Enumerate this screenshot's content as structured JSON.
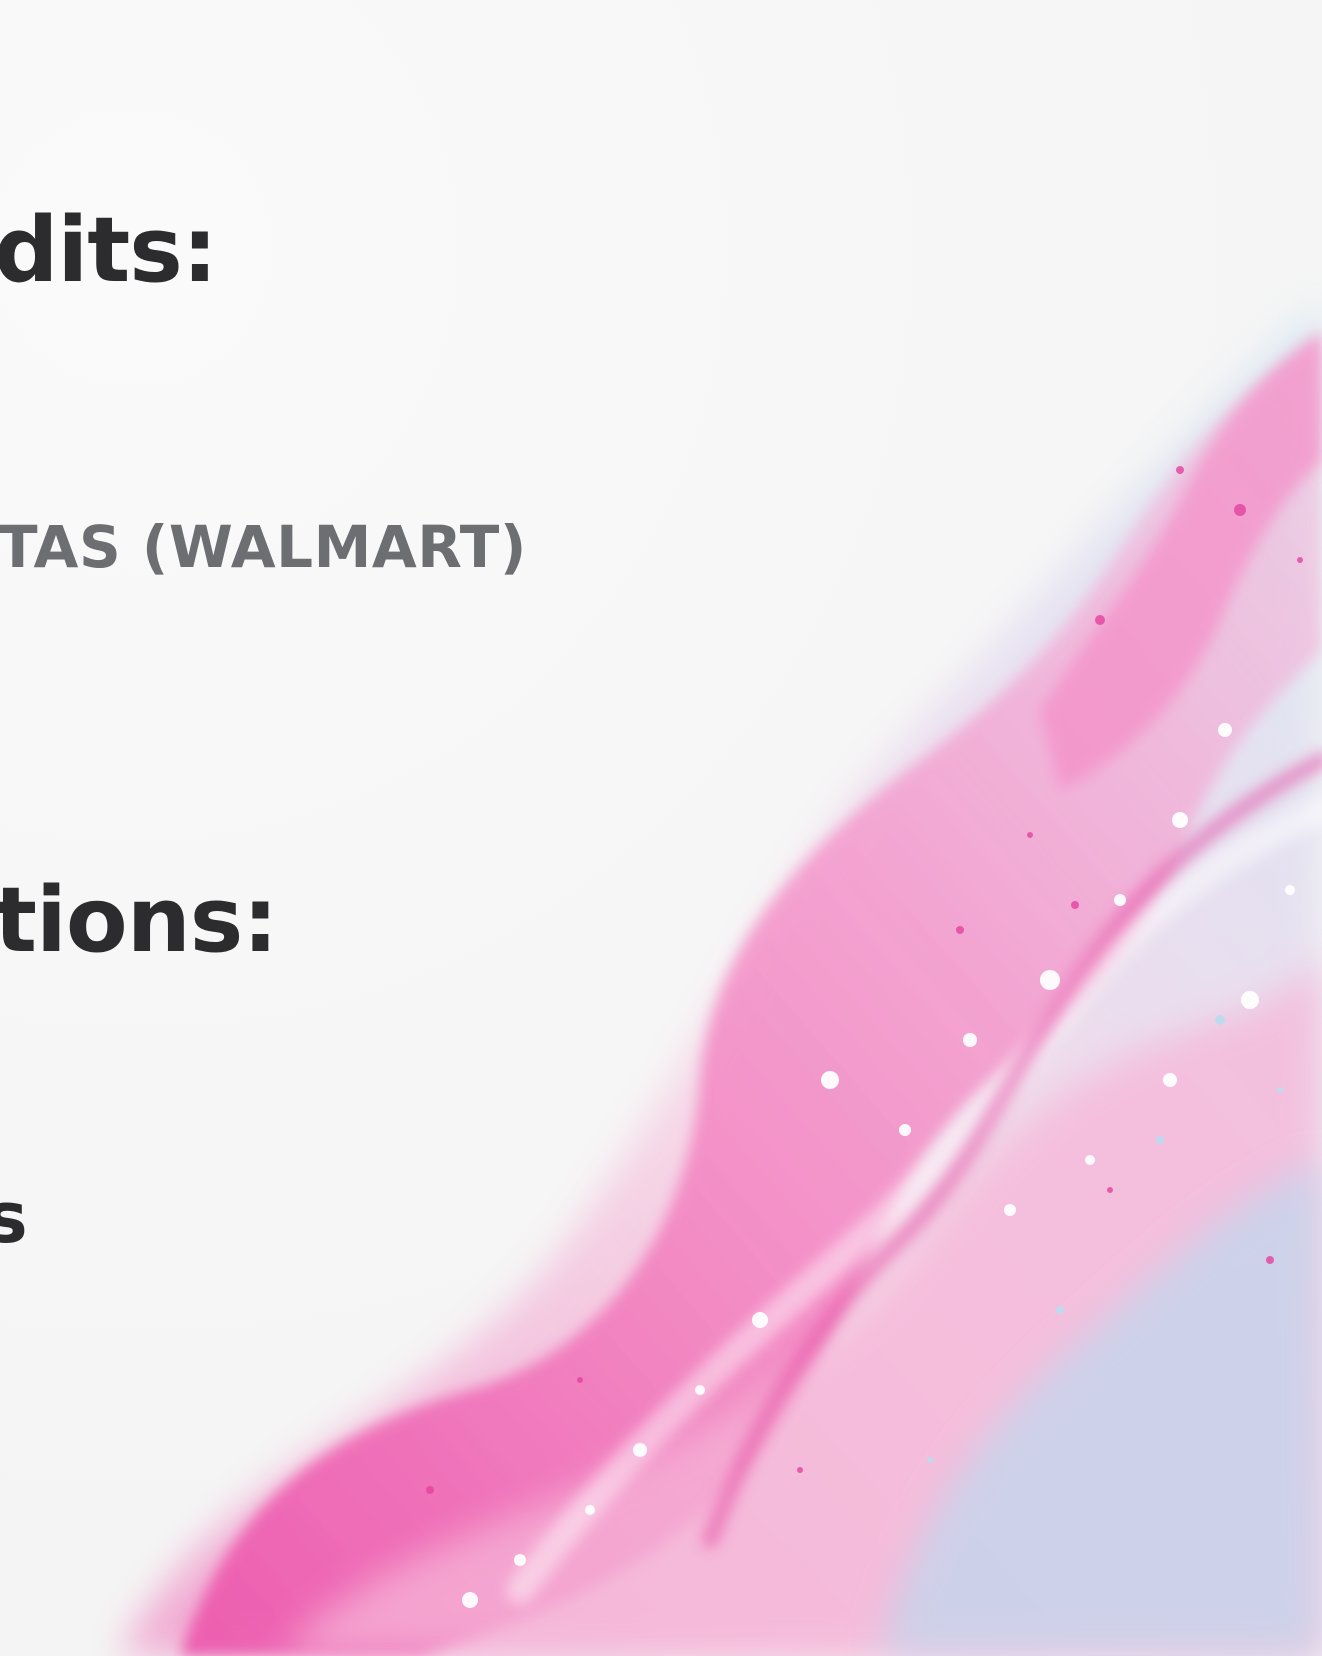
{
  "text": {
    "heading_credits": "dits:",
    "store_line": "TAS (WALMART)",
    "heading_sections": "tions:",
    "fragment": "s"
  },
  "colors": {
    "background": "#f6f6f6",
    "heading": "#2c2c2e",
    "subtext": "#6d6e72",
    "pink_primary": "#ec4fa9",
    "pink_light": "#f6b6d8",
    "blue_light": "#b9dcf1",
    "lilac": "#d6c9ec"
  }
}
